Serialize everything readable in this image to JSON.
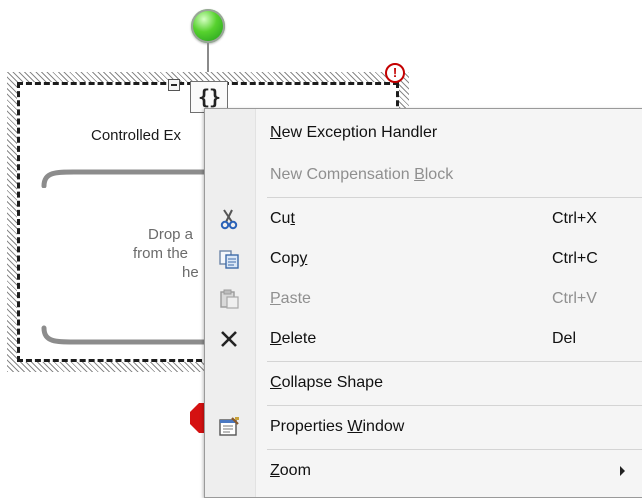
{
  "designer": {
    "scope_icon_glyph": "{}",
    "error_badge_glyph": "!",
    "shape_title": "Controlled Ex",
    "drop_text_lines": [
      "Drop a",
      "from the",
      "he"
    ]
  },
  "context_menu": {
    "items": [
      {
        "label": "New Exception Handler",
        "mnemonic": "N",
        "shortcut": "",
        "enabled": true,
        "icon": ""
      },
      {
        "label": "New Compensation Block",
        "mnemonic": "B",
        "shortcut": "",
        "enabled": false,
        "icon": ""
      },
      {
        "label": "Cut",
        "mnemonic": "t",
        "shortcut": "Ctrl+X",
        "enabled": true,
        "icon": "scissors-icon"
      },
      {
        "label": "Copy",
        "mnemonic": "y",
        "shortcut": "Ctrl+C",
        "enabled": true,
        "icon": "copy-icon"
      },
      {
        "label": "Paste",
        "mnemonic": "P",
        "shortcut": "Ctrl+V",
        "enabled": false,
        "icon": "paste-icon"
      },
      {
        "label": "Delete",
        "mnemonic": "D",
        "shortcut": "Del",
        "enabled": true,
        "icon": "delete-x-icon"
      },
      {
        "label": "Collapse Shape",
        "mnemonic": "C",
        "shortcut": "",
        "enabled": true,
        "icon": ""
      },
      {
        "label": "Properties Window",
        "mnemonic": "W",
        "shortcut": "",
        "enabled": true,
        "icon": "properties-window-icon"
      },
      {
        "label": "Zoom",
        "mnemonic": "Z",
        "shortcut": "",
        "enabled": true,
        "icon": "",
        "submenu": true
      }
    ]
  },
  "colors": {
    "start_node": "#3cc020",
    "end_node": "#d51111",
    "error_badge": "#c40000",
    "disabled_text": "#8f8f8f"
  }
}
